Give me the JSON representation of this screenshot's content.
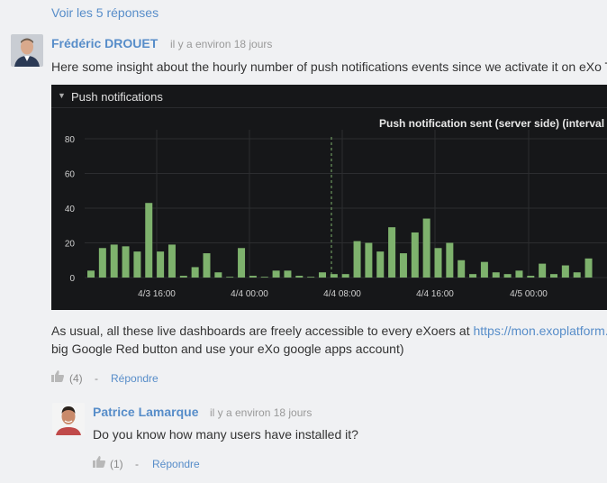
{
  "thread": {
    "view_replies": "Voir les 5 réponses"
  },
  "comment1": {
    "author": "Frédéric DROUET",
    "time": "il y a environ 18 jours",
    "text": "Here some insight about the hourly number of push notifications events since we activate it on eXo T",
    "after_line1_prefix": "As usual, all these live dashboards are freely accessible to every eXoers at ",
    "after_link": "https://mon.exoplatform.",
    "after_line2": "big Google Red button and use your eXo google apps account)",
    "likes": "(4)",
    "separator": "-",
    "reply": "Répondre"
  },
  "dashboard": {
    "header_title": "Push notifications",
    "chevron": "⌄"
  },
  "chart_data": {
    "type": "bar",
    "title": "Push notification sent (server side) (interval",
    "ylim": [
      0,
      80
    ],
    "yticks": [
      0,
      20,
      40,
      60,
      80
    ],
    "xtick_labels": [
      "4/3 16:00",
      "4/4 00:00",
      "4/4 08:00",
      "4/4 16:00",
      "4/5 00:00"
    ],
    "values": [
      4,
      17,
      19,
      18,
      15,
      43,
      15,
      19,
      1,
      6,
      14,
      3,
      0,
      17,
      1,
      0,
      4,
      4,
      1,
      0,
      3,
      2,
      2,
      21,
      20,
      15,
      29,
      14,
      26,
      34,
      17,
      20,
      10,
      2,
      9,
      3,
      2,
      4,
      1,
      8,
      2,
      7,
      3,
      11
    ],
    "bar_color": "#7eb26d",
    "grid": true
  },
  "comment2": {
    "author": "Patrice Lamarque",
    "time": "il y a environ 18 jours",
    "text": "Do you know how many users have installed it?",
    "likes": "(1)",
    "separator": "-",
    "reply": "Répondre"
  }
}
